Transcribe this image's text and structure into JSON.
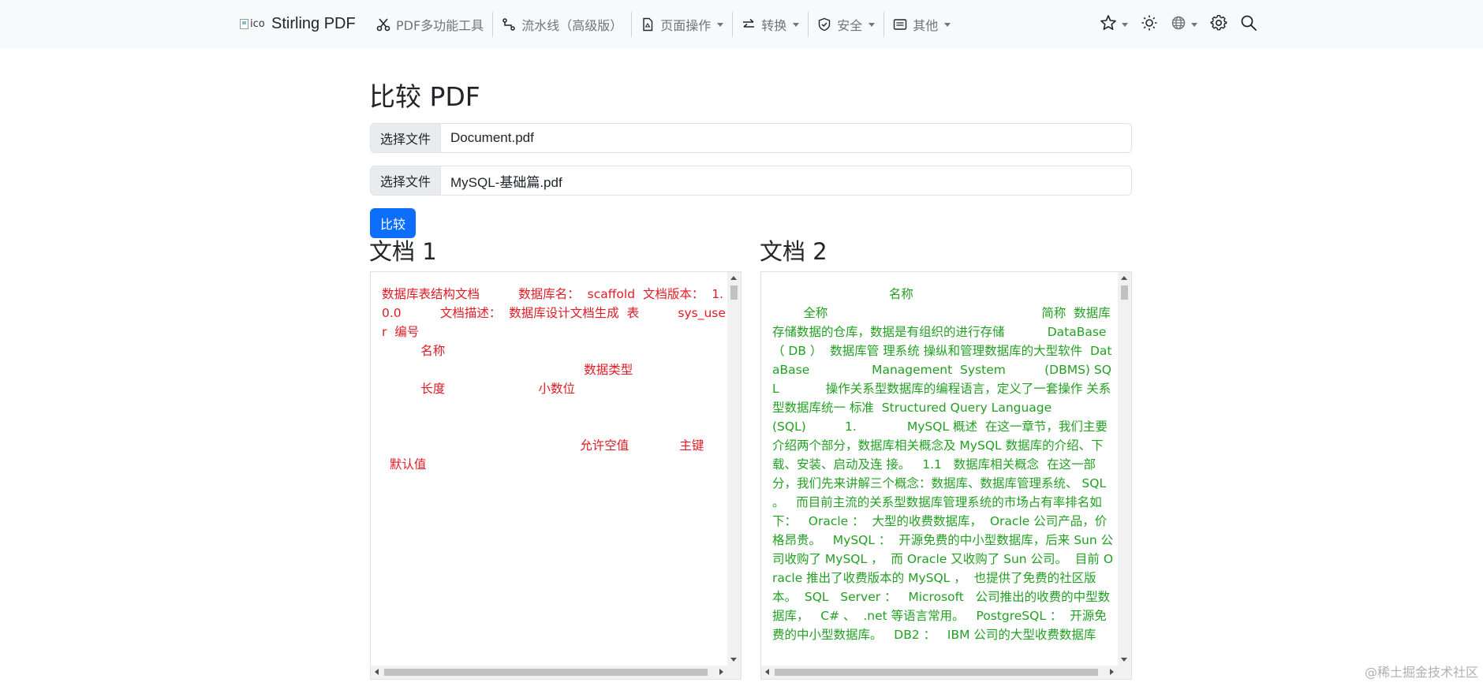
{
  "navbar": {
    "brand_text": "Stirling PDF",
    "brand_img_alt": "ico",
    "items": [
      {
        "label": "PDF多功能工具",
        "icon": "scissors-icon",
        "dropdown": false
      },
      {
        "label": "流水线（高级版）",
        "icon": "pipeline-icon",
        "dropdown": false
      },
      {
        "label": "页面操作",
        "icon": "file-icon",
        "dropdown": true
      },
      {
        "label": "转换",
        "icon": "arrows-exchange-icon",
        "dropdown": true
      },
      {
        "label": "安全",
        "icon": "shield-icon",
        "dropdown": true
      },
      {
        "label": "其他",
        "icon": "card-icon",
        "dropdown": true
      }
    ],
    "right_icons": [
      "star-icon",
      "sun-icon",
      "globe-icon",
      "gear-icon",
      "search-icon"
    ]
  },
  "main": {
    "title": "比较 PDF",
    "file1": {
      "button": "选择文件",
      "name": "Document.pdf"
    },
    "file2": {
      "button": "选择文件",
      "name": "MySQL-基础篇.pdf"
    },
    "compare_button": "比较",
    "doc1": {
      "title": "文档 1",
      "text": "数据库表结构文档          数据库名：  scaffold  文档版本：  1.0.0          文档描述：  数据库设计文档生成  表          sys_user  编号\n          名称\n                                                    数据类型\n          长度                        小数位\n\n\n                                                   允许空值             主键\n  默认值",
      "text_color": "#e01b24"
    },
    "doc2": {
      "title": "文档 2",
      "text": "                              名称\n        全称                                                       简称  数据库                    存储数据的仓库，数据是有组织的进行存储           DataBase  （ DB ）  数据库管 理系统 操纵和管理数据库的大型软件  DataBase                Management  System          (DBMS) SQL            操作关系型数据库的编程语言，定义了一套操作 关系型数据库统一 标准  Structured Query Language                 (SQL)          1.             MySQL 概述  在这一章节，我们主要介绍两个部分，数据库相关概念及 MySQL 数据库的介绍、下载、安装、启动及连 接。   1.1   数据库相关概念  在这一部分，我们先来讲解三个概念：数据库、数据库管理系统、 SQL 。   而目前主流的关系型数据库管理系统的市场占有率排名如下：   Oracle ：  大型的收费数据库，  Oracle 公司产品，价格昂贵。   MySQL ：  开源免费的中小型数据库，后来 Sun 公司收购了 MySQL ，  而 Oracle 又收购了 Sun 公司。  目前 Oracle 推出了收费版本的 MySQL ，  也提供了免费的社区版本。  SQL   Server ：   Microsoft   公司推出的收费的中型数据库，   C# 、  .net 等语言常用。   PostgreSQL ：  开源免费的中小型数据库。   DB2 ：   IBM 公司的大型收费数据库",
      "text_color": "#22a022"
    }
  },
  "watermark": "@稀土掘金技术社区",
  "colors": {
    "primary": "#0d6efd",
    "navbar_bg": "#f8f9fa"
  }
}
